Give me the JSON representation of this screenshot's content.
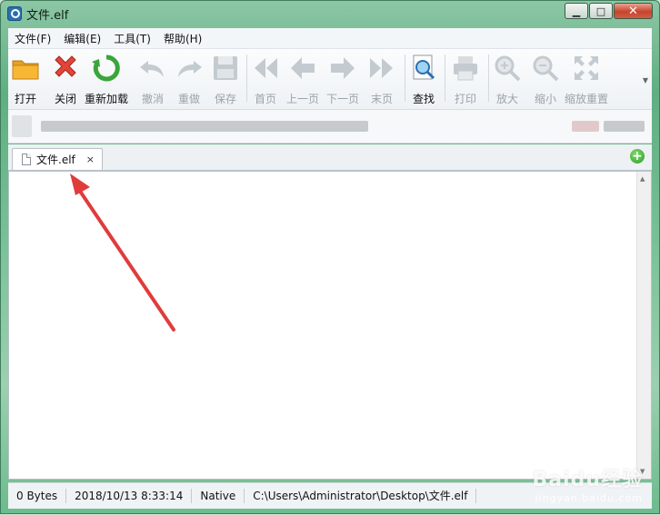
{
  "window": {
    "title": "文件.elf"
  },
  "menu": [
    "文件(F)",
    "编辑(E)",
    "工具(T)",
    "帮助(H)"
  ],
  "toolbar": [
    {
      "label": "打开",
      "icon": "folder-open-icon",
      "enabled": true
    },
    {
      "label": "关闭",
      "icon": "close-x-icon",
      "enabled": true
    },
    {
      "label": "重新加载",
      "icon": "reload-icon",
      "enabled": true
    },
    {
      "label": "撤消",
      "icon": "undo-icon",
      "enabled": false
    },
    {
      "label": "重做",
      "icon": "redo-icon",
      "enabled": false
    },
    {
      "label": "保存",
      "icon": "save-icon",
      "enabled": false
    },
    {
      "label": "首页",
      "icon": "first-page-icon",
      "enabled": false
    },
    {
      "label": "上一页",
      "icon": "prev-page-icon",
      "enabled": false
    },
    {
      "label": "下一页",
      "icon": "next-page-icon",
      "enabled": false
    },
    {
      "label": "末页",
      "icon": "last-page-icon",
      "enabled": false
    },
    {
      "label": "查找",
      "icon": "find-icon",
      "enabled": true
    },
    {
      "label": "打印",
      "icon": "print-icon",
      "enabled": false
    },
    {
      "label": "放大",
      "icon": "zoom-in-icon",
      "enabled": false
    },
    {
      "label": "缩小",
      "icon": "zoom-out-icon",
      "enabled": false
    },
    {
      "label": "缩放重置",
      "icon": "zoom-reset-icon",
      "enabled": false
    }
  ],
  "tabs": [
    {
      "label": "文件.elf",
      "close": "×"
    }
  ],
  "add_tab": "+",
  "status": {
    "size": "0 Bytes",
    "datetime": "2018/10/13 8:33:14",
    "encoding": "Native",
    "path": "C:\\Users\\Administrator\\Desktop\\文件.elf"
  },
  "watermark": {
    "logo": "Baidu经验",
    "url": "jingyan.baidu.com"
  },
  "colors": {
    "accent_red": "#e0453a",
    "annotation_arrow": "#e03c3c",
    "add_green": "#2f9a2a"
  }
}
